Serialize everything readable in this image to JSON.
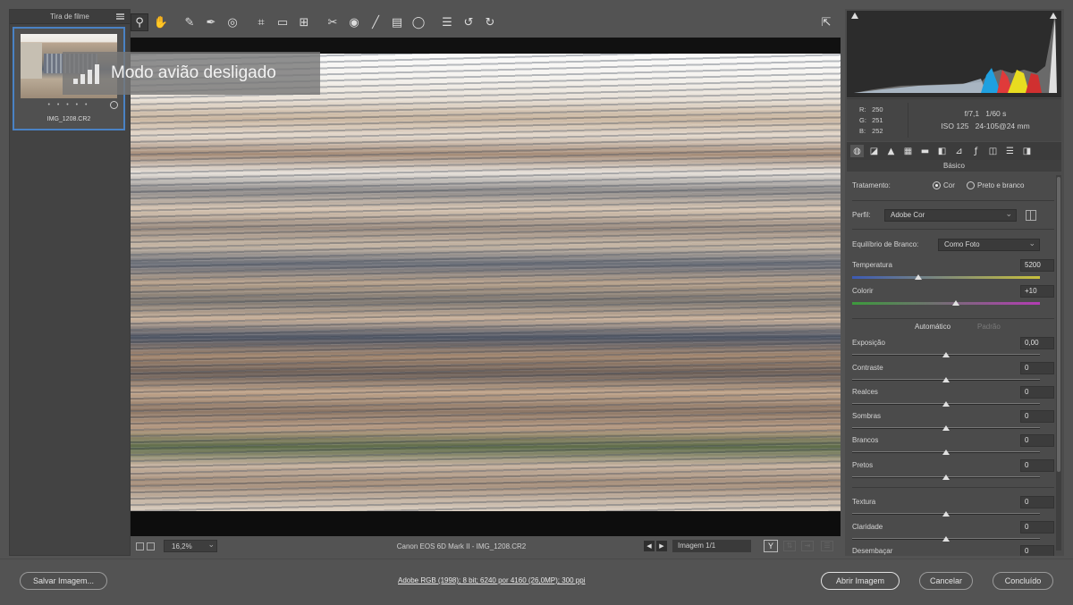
{
  "filmstrip": {
    "title": "Tira de filme",
    "thumb_name": "IMG_1208.CR2",
    "stars": "• • • • •"
  },
  "toast": {
    "text": "Modo avião desligado"
  },
  "toolbar": {
    "icons": [
      "zoom-icon",
      "hand-icon",
      "white-balance-icon",
      "color-sampler-icon",
      "targeted-adjust-icon",
      "crop-icon",
      "straighten-icon",
      "transform-icon",
      "spot-removal-icon",
      "red-eye-icon",
      "adjustment-brush-icon",
      "graduated-filter-icon",
      "radial-filter-icon",
      "preferences-icon",
      "rotate-left-icon",
      "rotate-right-icon",
      "fullscreen-icon"
    ]
  },
  "status": {
    "zoom": "16,2%",
    "camera": "Canon EOS 6D Mark II  -  IMG_1208.CR2",
    "image_count": "Imagem 1/1",
    "y_label": "Y"
  },
  "info": {
    "r_label": "R:",
    "r": "250",
    "g_label": "G:",
    "g": "251",
    "b_label": "B:",
    "b": "252",
    "aperture": "f/7,1",
    "shutter": "1/60 s",
    "iso": "ISO 125",
    "lens": "24-105@24 mm"
  },
  "panel": {
    "section_title": "Básico",
    "tratamento_label": "Tratamento:",
    "cor_label": "Cor",
    "pb_label": "Preto e branco",
    "perfil_label": "Perfil:",
    "perfil_value": "Adobe Cor",
    "wb_label": "Equilíbrio de Branco:",
    "wb_value": "Como Foto",
    "temperatura_label": "Temperatura",
    "temperatura_value": "5200",
    "temperatura_pos": 0.35,
    "colorir_label": "Colorir",
    "colorir_value": "+10",
    "colorir_pos": 0.55,
    "auto_label": "Automático",
    "default_label": "Padrão",
    "sliders": [
      {
        "label": "Exposição",
        "value": "0,00",
        "pos": 0.5
      },
      {
        "label": "Contraste",
        "value": "0",
        "pos": 0.5
      },
      {
        "label": "Realces",
        "value": "0",
        "pos": 0.5
      },
      {
        "label": "Sombras",
        "value": "0",
        "pos": 0.5
      },
      {
        "label": "Brancos",
        "value": "0",
        "pos": 0.5
      },
      {
        "label": "Pretos",
        "value": "0",
        "pos": 0.5
      },
      {
        "label": "Textura",
        "value": "0",
        "pos": 0.5
      },
      {
        "label": "Claridade",
        "value": "0",
        "pos": 0.5
      },
      {
        "label": "Desembaçar",
        "value": "0",
        "pos": 0.5
      }
    ]
  },
  "bottom": {
    "save_label": "Salvar Imagem...",
    "workflow": "Adobe RGB (1998); 8 bit; 6240 por 4160 (26,0MP); 300 ppi",
    "open_label": "Abrir Imagem",
    "cancel_label": "Cancelar",
    "done_label": "Concluído"
  },
  "colors": {
    "accent": "#4a82c4",
    "temp_start": "#3c5ab4",
    "temp_end": "#c8c03c",
    "tint_start": "#3c9a3c",
    "tint_end": "#b43cb4"
  }
}
